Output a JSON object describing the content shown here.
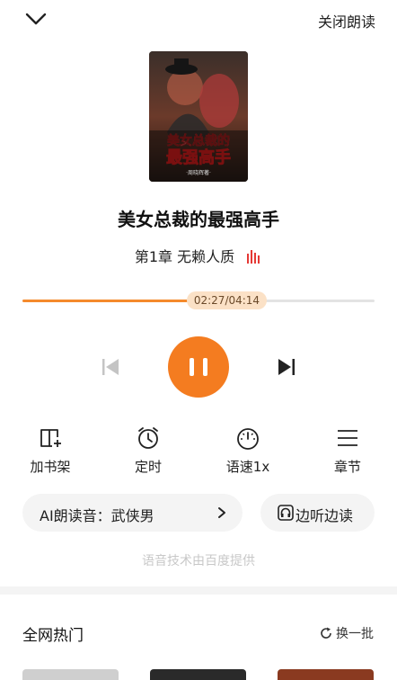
{
  "header": {
    "collapse_icon": "chevron-down-icon",
    "close_label": "关闭朗读"
  },
  "book": {
    "title": "美女总裁的最强高手",
    "cover_title_line1": "美女总裁的",
    "cover_title_line2": "最强高手",
    "cover_author": "·周晓辉著·"
  },
  "chapter": {
    "label": "第1章 无赖人质",
    "indicator_icon": "audio-wave-icon"
  },
  "progress": {
    "time_label": "02:27/04:14",
    "fraction": 0.58
  },
  "controls": {
    "prev_icon": "skip-previous-icon",
    "play_icon": "pause-icon",
    "next_icon": "skip-next-icon",
    "accent": "#f47c20"
  },
  "functions": [
    {
      "label": "加书架",
      "icon": "add-bookshelf-icon"
    },
    {
      "label": "定时",
      "icon": "alarm-clock-icon"
    },
    {
      "label": "语速1x",
      "icon": "speedometer-icon"
    },
    {
      "label": "章节",
      "icon": "menu-list-icon"
    }
  ],
  "voice": {
    "label": "AI朗读音：武侠男"
  },
  "listen": {
    "label": "边听边读"
  },
  "provider_note": "语音技术由百度提供",
  "hot": {
    "title": "全网热门",
    "refresh_label": "换一批"
  }
}
